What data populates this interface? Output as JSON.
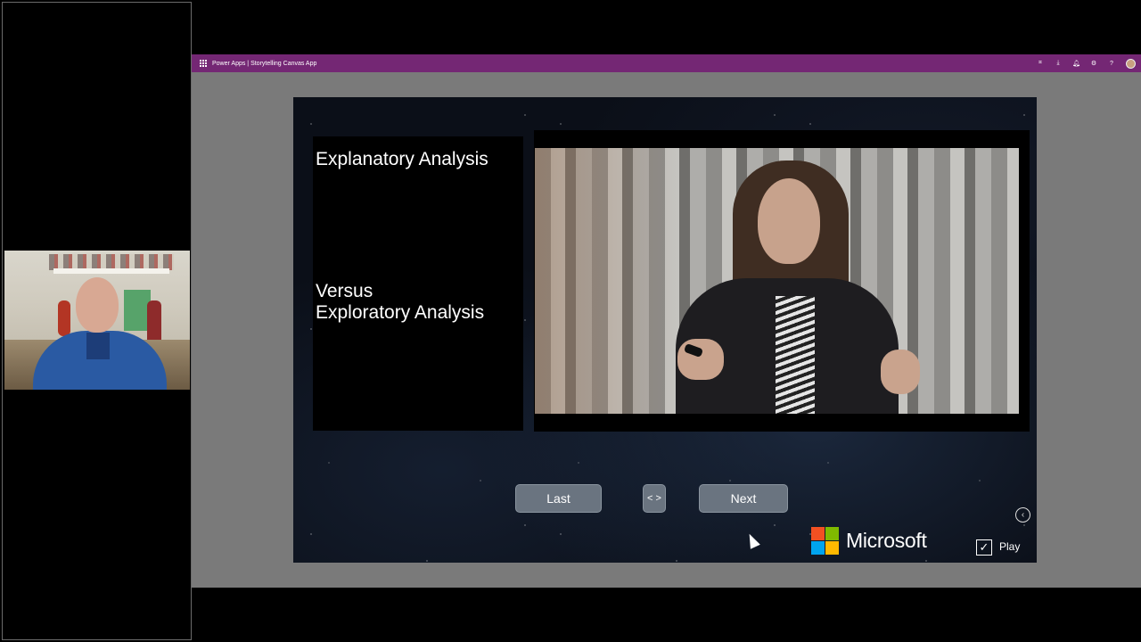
{
  "app": {
    "title": "Power Apps | Storytelling Canvas App",
    "header_icons": [
      "fit-to-screen-icon",
      "download-icon",
      "bell-icon",
      "settings-icon",
      "help-icon",
      "user-avatar-icon"
    ],
    "header_color": "#742774"
  },
  "slide": {
    "heading1": "Explanatory Analysis",
    "heading2_line1": "Versus",
    "heading2_line2": "Exploratory Analysis"
  },
  "nav": {
    "last_label": "Last",
    "toggle_label": "< >",
    "next_label": "Next"
  },
  "branding": {
    "microsoft_label": "Microsoft",
    "logo_colors": [
      "#f25022",
      "#7fba00",
      "#00a4ef",
      "#ffb900"
    ]
  },
  "controls": {
    "play_label": "Play",
    "play_checked": true,
    "check_glyph": "✓",
    "back_glyph": "‹"
  },
  "header_glyphs": {
    "fit": "⌗",
    "download": "⤓",
    "bell": "🔔︎",
    "settings": "⚙",
    "help": "?"
  }
}
